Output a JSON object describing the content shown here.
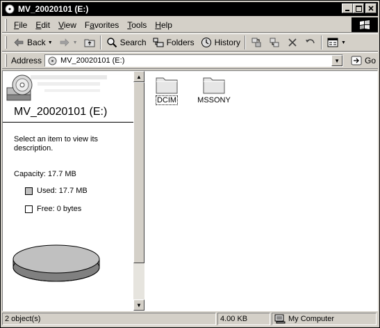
{
  "window": {
    "title": "MV_20020101 (E:)"
  },
  "menu": {
    "items": [
      {
        "label": "File",
        "accel": "F"
      },
      {
        "label": "Edit",
        "accel": "E"
      },
      {
        "label": "View",
        "accel": "V"
      },
      {
        "label": "Favorites",
        "accel": "a"
      },
      {
        "label": "Tools",
        "accel": "T"
      },
      {
        "label": "Help",
        "accel": "H"
      }
    ]
  },
  "toolbar": {
    "back_label": "Back",
    "search_label": "Search",
    "folders_label": "Folders",
    "history_label": "History"
  },
  "address": {
    "label": "Address",
    "value": "MV_20020101 (E:)",
    "go_label": "Go"
  },
  "left_pane": {
    "drive_title": "MV_20020101 (E:)",
    "description": "Select an item to view its description.",
    "capacity": "Capacity: 17.7 MB",
    "used": "Used: 17.7 MB",
    "free": "Free: 0 bytes",
    "used_fraction": 1.0,
    "used_color": "#c0c0c0",
    "free_color": "#ffffff"
  },
  "files": [
    {
      "name": "DCIM",
      "icon": "folder-icon",
      "focused": true
    },
    {
      "name": "MSSONY",
      "icon": "folder-icon",
      "focused": false
    }
  ],
  "status": {
    "objects": "2 object(s)",
    "size": "4.00 KB",
    "zone": "My Computer"
  }
}
